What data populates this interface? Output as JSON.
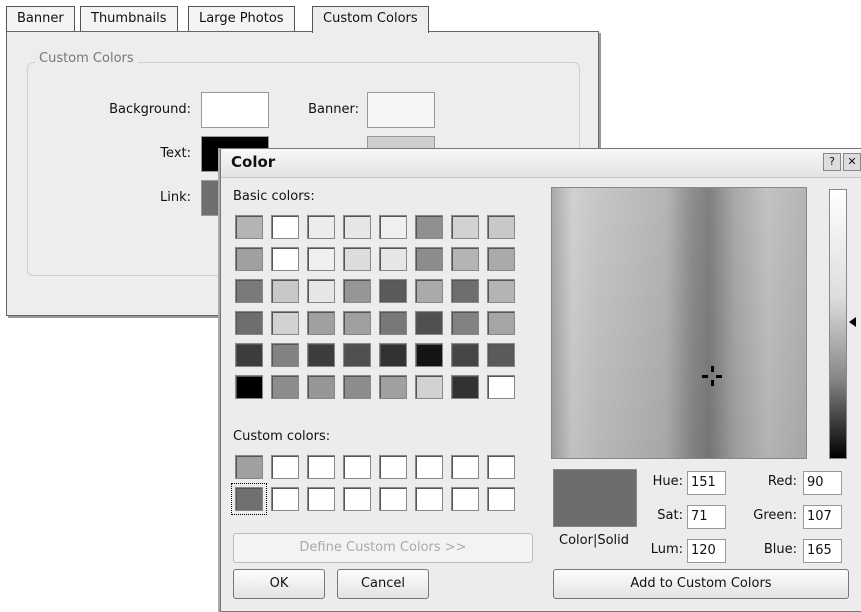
{
  "settings": {
    "tabs": [
      "Banner",
      "Thumbnails",
      "Large Photos",
      "Custom Colors"
    ],
    "group_title": "Custom Colors",
    "labels": {
      "background": "Background:",
      "banner": "Banner:",
      "text": "Text:",
      "link": "Link:"
    },
    "colors": {
      "background": "#ffffff",
      "banner": "#f6f6f6",
      "text": "#000000",
      "link": "#6f6f6f"
    }
  },
  "dialog": {
    "title": "Color",
    "help_glyph": "?",
    "close_glyph": "✕",
    "basic_colors_label": "Basic colors:",
    "custom_colors_label": "Custom colors:",
    "basic_colors": [
      [
        "#b4b4b4",
        "#ffffff",
        "#ececec",
        "#e6e6e6",
        "#efefef",
        "#909090",
        "#d2d2d2",
        "#c8c8c8"
      ],
      [
        "#a0a0a0",
        "#ffffff",
        "#f0f0f0",
        "#dcdcdc",
        "#e6e6e6",
        "#8c8c8c",
        "#b4b4b4",
        "#aaaaaa"
      ],
      [
        "#7a7a7a",
        "#c8c8c8",
        "#e6e6e6",
        "#969696",
        "#5a5a5a",
        "#aaaaaa",
        "#6e6e6e",
        "#b4b4b4"
      ],
      [
        "#6e6e6e",
        "#d2d2d2",
        "#a0a0a0",
        "#a0a0a0",
        "#787878",
        "#505050",
        "#828282",
        "#a5a5a5"
      ],
      [
        "#3c3c3c",
        "#828282",
        "#3c3c3c",
        "#505050",
        "#323232",
        "#141414",
        "#464646",
        "#5a5a5a"
      ],
      [
        "#000000",
        "#8c8c8c",
        "#969696",
        "#8c8c8c",
        "#a0a0a0",
        "#d2d2d2",
        "#323232",
        "#ffffff"
      ]
    ],
    "custom_colors": [
      [
        "#a0a0a0",
        "#ffffff",
        "#ffffff",
        "#ffffff",
        "#ffffff",
        "#ffffff",
        "#ffffff",
        "#ffffff"
      ],
      [
        "#707070",
        "#ffffff",
        "#ffffff",
        "#ffffff",
        "#ffffff",
        "#ffffff",
        "#ffffff",
        "#ffffff"
      ]
    ],
    "define_button": "Define Custom Colors >>",
    "ok_button": "OK",
    "cancel_button": "Cancel",
    "color_solid_label": "Color|Solid",
    "color_solid_swatch": "#6d6d6d",
    "hue": {
      "label": "Hue:",
      "value": "151"
    },
    "sat": {
      "label": "Sat:",
      "value": "71"
    },
    "lum": {
      "label": "Lum:",
      "value": "120"
    },
    "red": {
      "label": "Red:",
      "value": "90"
    },
    "green": {
      "label": "Green:",
      "value": "107"
    },
    "blue": {
      "label": "Blue:",
      "value": "165"
    },
    "add_button": "Add to Custom Colors"
  }
}
